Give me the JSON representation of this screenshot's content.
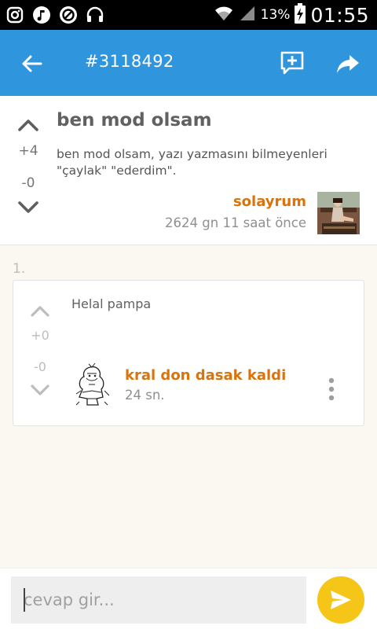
{
  "status_bar": {
    "battery": "13%",
    "time": "01:55",
    "icons": [
      "instagram-icon",
      "music-icon",
      "blocked-icon",
      "headset-icon",
      "wifi-icon",
      "signal-icon",
      "battery-charging-icon"
    ]
  },
  "app_bar": {
    "title": "#3118492",
    "icons": [
      "back-arrow-icon",
      "add-comment-icon",
      "share-icon"
    ],
    "background": "#2f95dc"
  },
  "post": {
    "title": "ben mod olsam",
    "body": "ben mod olsam, yazı yazmasını bilmeyenleri \"çaylak\" \"ederdim\".",
    "upvotes": "+4",
    "downvotes": "-0",
    "author": "solayrum",
    "time": "2624 gn 11 saat  önce"
  },
  "replies": [
    {
      "index": "1.",
      "text": "Helal pampa",
      "upvotes": "+0",
      "downvotes": "-0",
      "author": "kral don dasak kaldi",
      "time": "24 sn."
    }
  ],
  "input": {
    "placeholder": "cevap gir..."
  },
  "colors": {
    "accent": "#2f95dc",
    "author": "#d9730d",
    "send": "#f5c518"
  }
}
